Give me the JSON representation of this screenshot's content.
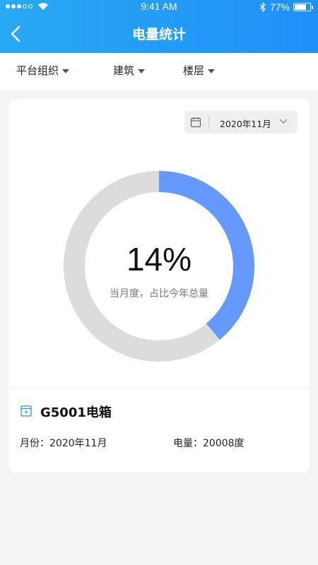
{
  "status_bar": {
    "time": "9:41 AM",
    "battery_percent": "77%",
    "battery_level": 0.77
  },
  "header": {
    "title": "电量统计"
  },
  "filters": [
    {
      "label": "平台组织"
    },
    {
      "label": "建筑"
    },
    {
      "label": "楼层"
    }
  ],
  "date_picker": {
    "value": "2020年11月"
  },
  "donut": {
    "percent_label": "14%",
    "fraction_shown": 0.39,
    "caption": "当月度，占比今年总量",
    "colors": {
      "filled": "#6699ff",
      "track": "#dcdcdc"
    }
  },
  "device": {
    "name": "G5001电箱",
    "month_label": "月份：",
    "month_value": "2020年11月",
    "power_label": "电量：",
    "power_value": "20008度"
  },
  "colors": {
    "header": "#1e90f8",
    "accent": "#6699ff"
  }
}
